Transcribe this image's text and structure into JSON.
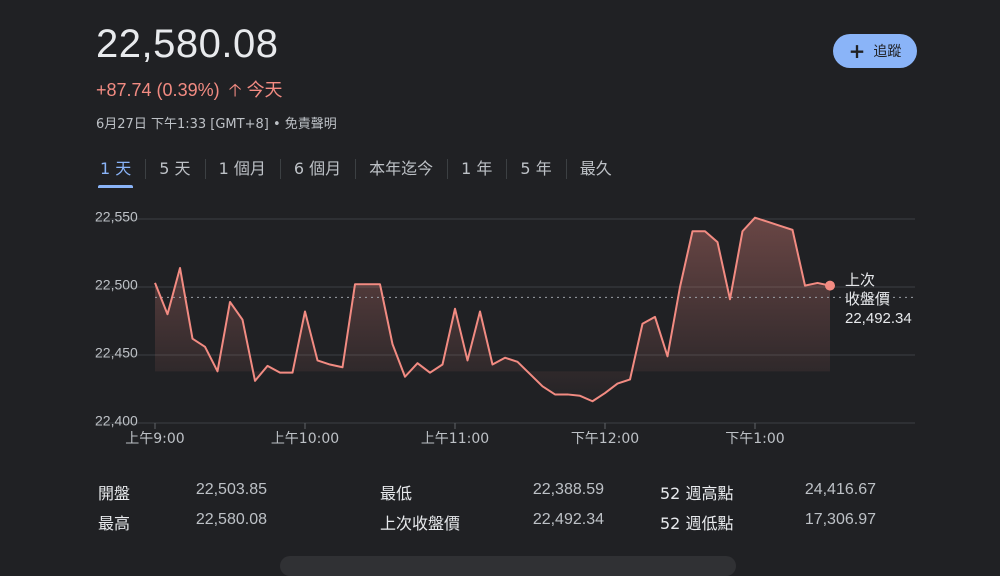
{
  "header": {
    "title_partial": "",
    "price": "22,580.08",
    "change": "+87.74 (0.39%)",
    "change_period": "今天",
    "timestamp": "6月27日 下午1:33 [GMT+8] • 免責聲明",
    "follow_label": "追蹤"
  },
  "tabs": [
    "1 天",
    "5 天",
    "1 個月",
    "6 個月",
    "本年迄今",
    "1 年",
    "5 年",
    "最久"
  ],
  "active_tab": 0,
  "colors": {
    "line": "#f28b82",
    "accent": "#8ab4f8",
    "background": "#202124"
  },
  "chart_data": {
    "type": "line",
    "ylim": [
      22400,
      22550
    ],
    "y_ticks": [
      "22,550",
      "22,500",
      "22,450",
      "22,400"
    ],
    "x_ticks": [
      "上午9:00",
      "上午10:00",
      "上午11:00",
      "下午12:00",
      "下午1:00"
    ],
    "x_unit": "minutes after 9:00",
    "xlim": [
      0,
      300
    ],
    "x": [
      0,
      5,
      10,
      15,
      20,
      25,
      30,
      35,
      40,
      45,
      50,
      55,
      60,
      65,
      70,
      75,
      80,
      85,
      90,
      95,
      100,
      105,
      110,
      115,
      120,
      125,
      130,
      135,
      140,
      145,
      150,
      155,
      160,
      165,
      170,
      175,
      180,
      185,
      190,
      195,
      200,
      205,
      210,
      215,
      220,
      225,
      230,
      235,
      240,
      245,
      250,
      255,
      260,
      265,
      270
    ],
    "values": [
      22503,
      22480,
      22514,
      22462,
      22456,
      22438,
      22489,
      22476,
      22431,
      22442,
      22437,
      22437,
      22482,
      22446,
      22443,
      22441,
      22502,
      22502,
      22502,
      22458,
      22434,
      22444,
      22437,
      22443,
      22484,
      22446,
      22482,
      22443,
      22448,
      22445,
      22436,
      22427,
      22421,
      22421,
      22420,
      22416,
      22422,
      22429,
      22432,
      22473,
      22478,
      22449,
      22500,
      22541,
      22541,
      22533,
      22491,
      22541,
      22551,
      22548,
      22545,
      22542,
      22501,
      22503,
      22501
    ],
    "previous_close": 22492.34,
    "previous_close_label_line1": "上次",
    "previous_close_label_line2": "收盤價",
    "previous_close_value": "22,492.34"
  },
  "stats": [
    {
      "label": "開盤",
      "value": "22,503.85"
    },
    {
      "label": "最高",
      "value": "22,580.08"
    },
    {
      "label": "最低",
      "value": "22,388.59"
    },
    {
      "label": "上次收盤價",
      "value": "22,492.34"
    },
    {
      "label": "52 週高點",
      "value": "24,416.67"
    },
    {
      "label": "52 週低點",
      "value": "17,306.97"
    }
  ]
}
